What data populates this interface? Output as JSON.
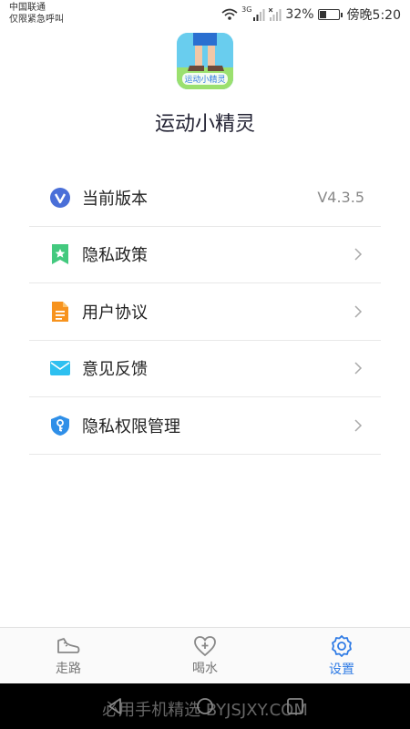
{
  "status_bar": {
    "carrier": "中国联通",
    "emergency": "仅限紧急呼叫",
    "network": "3G",
    "battery": "32%",
    "battery_level": 0.32,
    "time": "傍晚5:20"
  },
  "app": {
    "logo_text": "运动小精灵",
    "name": "运动小精灵"
  },
  "menu": {
    "items": [
      {
        "label": "当前版本",
        "value": "V4.3.5",
        "icon": "version-v-icon"
      },
      {
        "label": "隐私政策",
        "icon": "bookmark-star-icon"
      },
      {
        "label": "用户协议",
        "icon": "document-icon"
      },
      {
        "label": "意见反馈",
        "icon": "mail-icon"
      },
      {
        "label": "隐私权限管理",
        "icon": "shield-key-icon"
      }
    ]
  },
  "tabbar": {
    "tabs": [
      {
        "label": "走路",
        "icon": "shoe-icon",
        "active": false
      },
      {
        "label": "喝水",
        "icon": "heart-plus-icon",
        "active": false
      },
      {
        "label": "设置",
        "icon": "gear-icon",
        "active": true
      }
    ]
  },
  "navbar": {
    "watermark": "必用手机精选 BYJSJXY.COM"
  },
  "colors": {
    "accent": "#2f7be5",
    "text": "#222222",
    "muted": "#888888"
  }
}
